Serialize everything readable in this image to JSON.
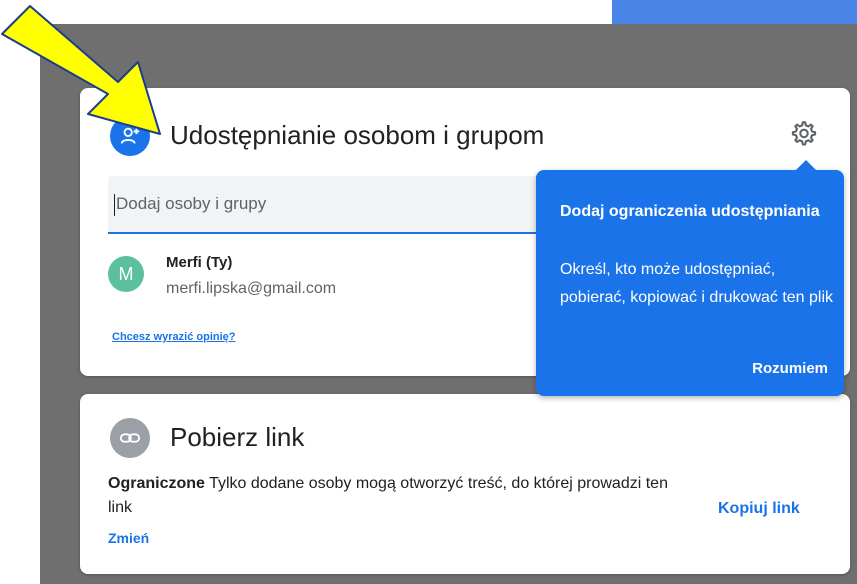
{
  "share": {
    "title": "Udostępnianie osobom i grupom",
    "input_placeholder": "Dodaj osoby i grupy",
    "user": {
      "avatar_letter": "M",
      "avatar_color": "#5bc0a0",
      "name": "Merfi (Ty)",
      "email": "merfi.lipska@gmail.com"
    },
    "feedback_link": "Chcesz wyrazić opinię?"
  },
  "tooltip": {
    "title": "Dodaj ograniczenia udostępniania",
    "body": "Określ, kto może udostępniać, pobierać, kopiować i drukować ten plik",
    "button": "Rozumiem"
  },
  "link": {
    "title": "Pobierz link",
    "access_level": "Ograniczone",
    "access_description": "Tylko dodane osoby mogą otworzyć treść, do której prowadzi ten link",
    "change_label": "Zmień",
    "copy_label": "Kopiuj link"
  },
  "colors": {
    "accent": "#1a73e8",
    "arrow_fill": "#ffff00",
    "arrow_stroke": "#1a3d8f"
  },
  "icons": {
    "share_icon": "person-add-icon",
    "settings_icon": "gear-icon",
    "link_icon": "link-icon"
  }
}
